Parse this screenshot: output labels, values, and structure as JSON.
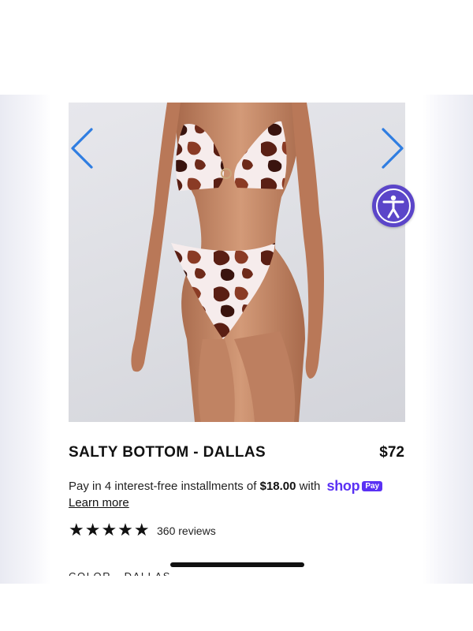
{
  "product": {
    "title": "SALTY BOTTOM - DALLAS",
    "price": "$72",
    "image_alt": "Model wearing cow print bikini top and high-cut bottom"
  },
  "payment": {
    "prefix": "Pay in 4 interest-free installments of ",
    "amount": "$18.00",
    "suffix": " with ",
    "brand": "shop",
    "badge": "Pay",
    "learn_more": "Learn more"
  },
  "rating": {
    "stars": "★★★★★",
    "value": 5,
    "reviews_label": "360 reviews"
  },
  "options": {
    "color_label": "COLOR - DALLAS"
  },
  "icons": {
    "prev": "chevron-left-icon",
    "next": "chevron-right-icon",
    "accessibility": "accessibility-icon"
  },
  "colors": {
    "arrow": "#2f7de1",
    "accessibility_bg": "#5b45c9",
    "shop_brand": "#5a31f4",
    "print_brown": "#5a1f14",
    "skin": "#c98a66"
  }
}
